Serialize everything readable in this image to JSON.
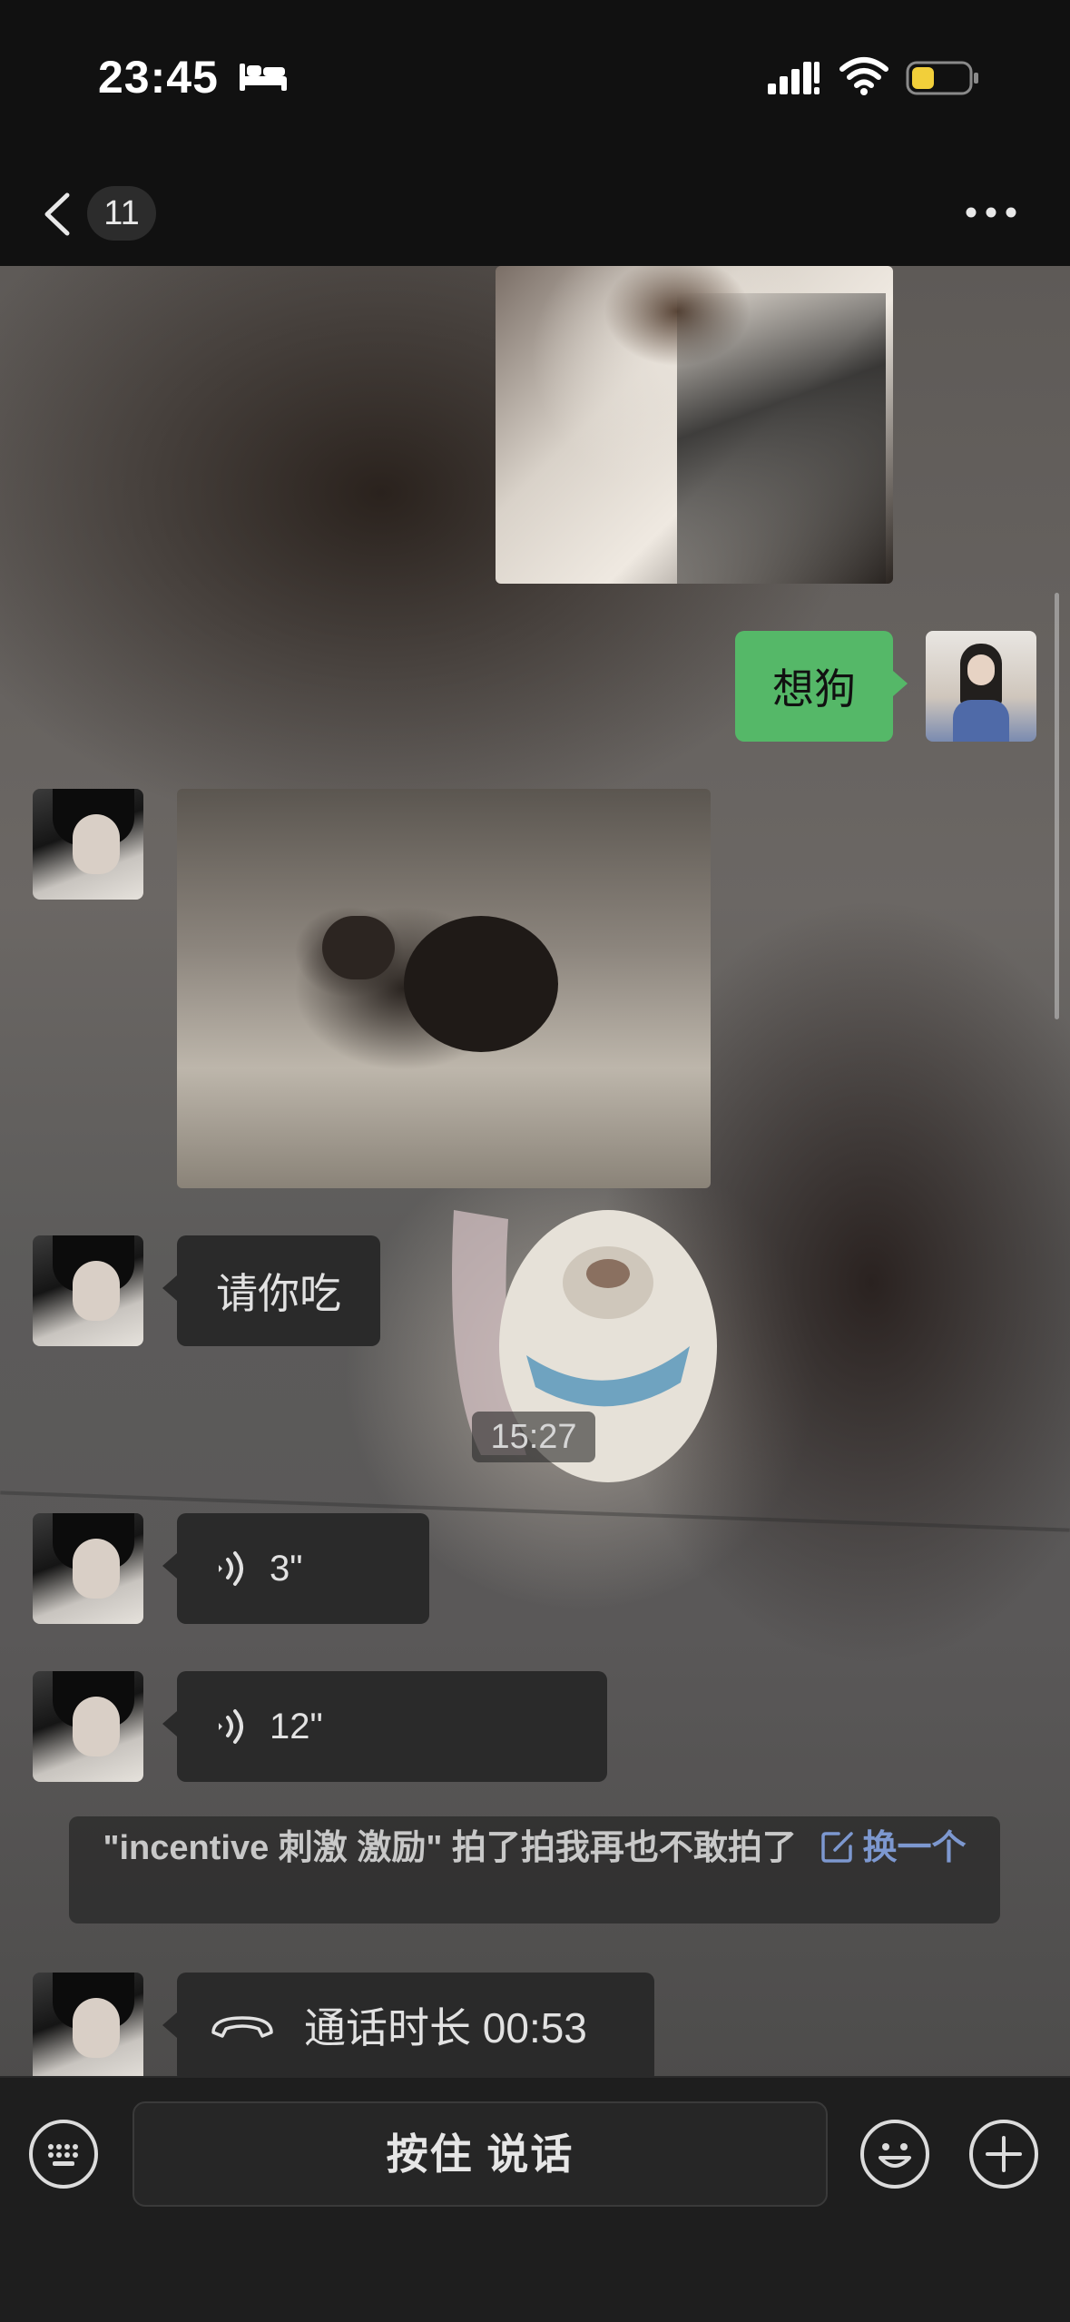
{
  "status_bar": {
    "time": "23:45",
    "icons": [
      "bed-icon",
      "cellular-signal-icon",
      "wifi-icon",
      "battery-icon"
    ],
    "battery_color": "#f2cf3a"
  },
  "nav": {
    "unread_count": "11",
    "icons": [
      "back-chevron-icon",
      "more-dots-icon"
    ]
  },
  "messages": [
    {
      "type": "image",
      "sender": "other",
      "content": "cat-photo"
    },
    {
      "type": "text",
      "sender": "self",
      "text": "想狗"
    },
    {
      "type": "image",
      "sender": "other",
      "content": "cat-on-bed-photo"
    },
    {
      "type": "text",
      "sender": "other",
      "text": "请你吃"
    },
    {
      "type": "time",
      "text": "15:27"
    },
    {
      "type": "voice",
      "sender": "other",
      "duration": "3\""
    },
    {
      "type": "voice",
      "sender": "other",
      "duration": "12\""
    },
    {
      "type": "system",
      "text": "\"incentive 刺激 激励\" 拍了拍我再也不敢拍了",
      "link": "换一个"
    },
    {
      "type": "call",
      "sender": "other",
      "text": "通话时长 00:53"
    }
  ],
  "input_bar": {
    "hold_to_talk": "按住 说话",
    "icons": [
      "keyboard-icon",
      "emoji-icon",
      "plus-icon"
    ]
  },
  "colors": {
    "self_bubble": "#55b868",
    "other_bubble": "#2a2a2a",
    "link": "#7d98d0",
    "background": "#111111"
  }
}
